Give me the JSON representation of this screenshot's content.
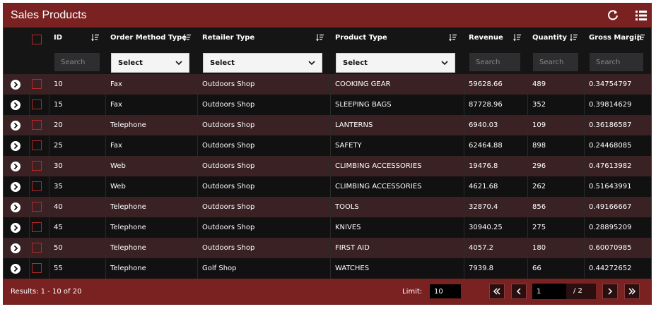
{
  "header": {
    "title": "Sales Products",
    "refresh_icon": "refresh-icon",
    "menu_icon": "list-menu-icon"
  },
  "columns": [
    {
      "key": "id",
      "label": "ID",
      "filter": {
        "type": "input",
        "placeholder": "Search"
      }
    },
    {
      "key": "order_method_type",
      "label": "Order Method Type",
      "filter": {
        "type": "select",
        "value": "Select"
      }
    },
    {
      "key": "retailer_type",
      "label": "Retailer Type",
      "filter": {
        "type": "select",
        "value": "Select"
      }
    },
    {
      "key": "product_type",
      "label": "Product Type",
      "filter": {
        "type": "select",
        "value": "Select"
      }
    },
    {
      "key": "revenue",
      "label": "Revenue",
      "filter": {
        "type": "input",
        "placeholder": "Search"
      }
    },
    {
      "key": "quantity",
      "label": "Quantity",
      "filter": {
        "type": "input",
        "placeholder": "Search"
      }
    },
    {
      "key": "gross_margin",
      "label": "Gross Margin",
      "filter": {
        "type": "input",
        "placeholder": "Search"
      }
    }
  ],
  "rows": [
    {
      "id": "10",
      "order_method_type": "Fax",
      "retailer_type": "Outdoors Shop",
      "product_type": "COOKING GEAR",
      "revenue": "59628.66",
      "quantity": "489",
      "gross_margin": "0.34754797"
    },
    {
      "id": "15",
      "order_method_type": "Fax",
      "retailer_type": "Outdoors Shop",
      "product_type": "SLEEPING BAGS",
      "revenue": "87728.96",
      "quantity": "352",
      "gross_margin": "0.39814629"
    },
    {
      "id": "20",
      "order_method_type": "Telephone",
      "retailer_type": "Outdoors Shop",
      "product_type": "LANTERNS",
      "revenue": "6940.03",
      "quantity": "109",
      "gross_margin": "0.36186587"
    },
    {
      "id": "25",
      "order_method_type": "Fax",
      "retailer_type": "Outdoors Shop",
      "product_type": "SAFETY",
      "revenue": "62464.88",
      "quantity": "898",
      "gross_margin": "0.24468085"
    },
    {
      "id": "30",
      "order_method_type": "Web",
      "retailer_type": "Outdoors Shop",
      "product_type": "CLIMBING ACCESSORIES",
      "revenue": "19476.8",
      "quantity": "296",
      "gross_margin": "0.47613982"
    },
    {
      "id": "35",
      "order_method_type": "Web",
      "retailer_type": "Outdoors Shop",
      "product_type": "CLIMBING ACCESSORIES",
      "revenue": "4621.68",
      "quantity": "262",
      "gross_margin": "0.51643991"
    },
    {
      "id": "40",
      "order_method_type": "Telephone",
      "retailer_type": "Outdoors Shop",
      "product_type": "TOOLS",
      "revenue": "32870.4",
      "quantity": "856",
      "gross_margin": "0.49166667"
    },
    {
      "id": "45",
      "order_method_type": "Telephone",
      "retailer_type": "Outdoors Shop",
      "product_type": "KNIVES",
      "revenue": "30940.25",
      "quantity": "275",
      "gross_margin": "0.28895209"
    },
    {
      "id": "50",
      "order_method_type": "Telephone",
      "retailer_type": "Outdoors Shop",
      "product_type": "FIRST AID",
      "revenue": "4057.2",
      "quantity": "180",
      "gross_margin": "0.60070985"
    },
    {
      "id": "55",
      "order_method_type": "Telephone",
      "retailer_type": "Golf Shop",
      "product_type": "WATCHES",
      "revenue": "7939.8",
      "quantity": "66",
      "gross_margin": "0.44272652"
    }
  ],
  "footer": {
    "results_text": "Results: 1 - 10 of 20",
    "limit_label": "Limit:",
    "limit_value": "10",
    "current_page": "1",
    "total_pages_text": "/ 2"
  },
  "colors": {
    "brand": "#7a2222",
    "row_odd": "#3a2224",
    "row_even": "#111111",
    "checkbox_border": "#b12a2a"
  }
}
